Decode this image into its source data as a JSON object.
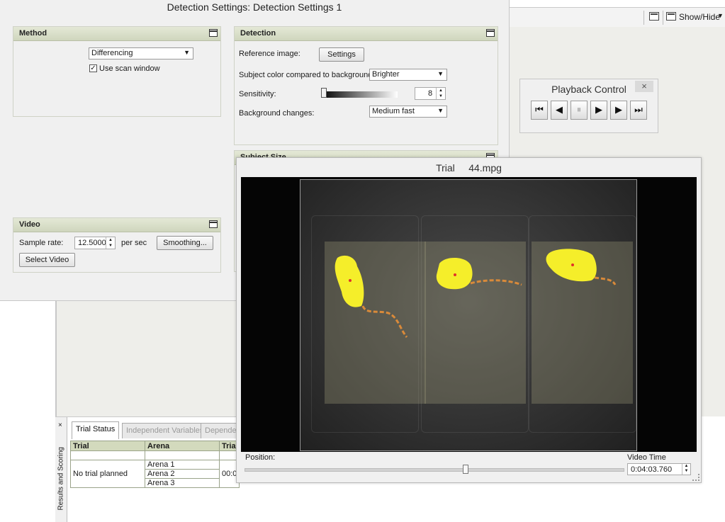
{
  "toolbar": {
    "show_hide_label": "Show/Hide"
  },
  "detection_settings": {
    "title": "Detection Settings: Detection Settings 1",
    "method": {
      "title": "Method",
      "select_value": "Differencing",
      "scan_window_label": "Use scan window",
      "scan_window_checked": true
    },
    "detection": {
      "title": "Detection",
      "reference_label": "Reference image:",
      "settings_button": "Settings",
      "subject_color_label": "Subject color compared to background:",
      "subject_color_value": "Brighter",
      "sensitivity_label": "Sensitivity:",
      "sensitivity_value": "8",
      "bg_changes_label": "Background changes:",
      "bg_changes_value": "Medium fast"
    },
    "subject_size": {
      "title": "Subject Size"
    },
    "video": {
      "title": "Video",
      "sample_rate_label": "Sample rate:",
      "sample_rate_value": "12.5000",
      "per_sec_label": "per sec",
      "smoothing_button": "Smoothing...",
      "select_video_button": "Select Video"
    }
  },
  "playback": {
    "title": "Playback Control",
    "close": "×",
    "buttons": [
      "⏮",
      "◀",
      "⏸",
      "▶",
      "▶",
      "⏭"
    ]
  },
  "results": {
    "side_label": "Results and Scoring",
    "close": "×",
    "tabs": [
      "Trial Status",
      "Independent Variables",
      "Dependen"
    ],
    "headers": [
      "Trial",
      "Arena",
      "Tria"
    ],
    "trial_cell": "No trial planned",
    "arenas": [
      "Arena 1",
      "Arena 2",
      "Arena 3"
    ],
    "time_cell": "00:0"
  },
  "video": {
    "title": "Trial     44.mpg",
    "position_label": "Position:",
    "position_fraction": 0.58,
    "video_time_label": "Video Time",
    "video_time_value": "0:04:03.760"
  },
  "colors": {
    "subject": "#f5ee2a",
    "tail": "#d98a3a",
    "center": "#e0302a"
  }
}
